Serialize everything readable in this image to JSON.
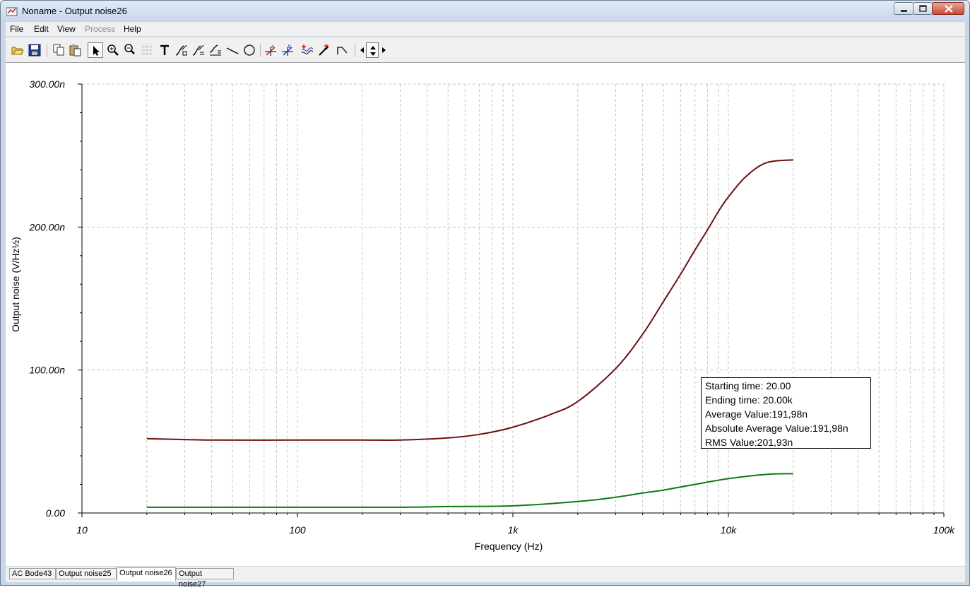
{
  "window": {
    "title": "Noname - Output noise26"
  },
  "menu": [
    {
      "label": "File",
      "enabled": true
    },
    {
      "label": "Edit",
      "enabled": true
    },
    {
      "label": "View",
      "enabled": true
    },
    {
      "label": "Process",
      "enabled": false
    },
    {
      "label": "Help",
      "enabled": true
    }
  ],
  "toolbar": {
    "icons": [
      "open-icon",
      "save-icon",
      "copy-icon",
      "paste-icon",
      "pointer-icon",
      "zoom-in-icon",
      "zoom-out-icon",
      "grid-icon",
      "text-icon",
      "curve-label-icon",
      "curve-label-2-icon",
      "axis-label-icon",
      "line-icon",
      "circle-icon",
      "cursor-a-icon",
      "cursor-b-icon",
      "waveform-icon",
      "probe-icon",
      "step-icon",
      "nav-left-icon",
      "nav-up-down-icon",
      "nav-right-icon"
    ]
  },
  "chart_data": {
    "type": "line",
    "x_scale": "log",
    "xlabel": "Frequency (Hz)",
    "ylabel": "Output noise (V/Hz½)",
    "xlim": [
      10,
      100000
    ],
    "ylim": [
      0,
      300
    ],
    "x_tick_labels": [
      "10",
      "100",
      "1k",
      "10k",
      "100k"
    ],
    "y_tick_labels": [
      "0.00",
      "100.00n",
      "200.00n",
      "300.00n"
    ],
    "y_unit": "n",
    "grid": true,
    "series": [
      {
        "color": "#6b0f0f",
        "points": [
          [
            20,
            52
          ],
          [
            40,
            51
          ],
          [
            100,
            51
          ],
          [
            200,
            51
          ],
          [
            300,
            51
          ],
          [
            500,
            52.5
          ],
          [
            700,
            55
          ],
          [
            1000,
            60
          ],
          [
            1500,
            69
          ],
          [
            2000,
            78
          ],
          [
            3000,
            101
          ],
          [
            4000,
            125
          ],
          [
            5000,
            148
          ],
          [
            6000,
            167
          ],
          [
            7000,
            184
          ],
          [
            8000,
            198
          ],
          [
            9000,
            211
          ],
          [
            10000,
            221
          ],
          [
            12000,
            235
          ],
          [
            15000,
            245
          ],
          [
            20000,
            247
          ]
        ]
      },
      {
        "color": "#0f7a0f",
        "points": [
          [
            20,
            4
          ],
          [
            100,
            4
          ],
          [
            300,
            4
          ],
          [
            500,
            4.5
          ],
          [
            1000,
            5
          ],
          [
            2000,
            8
          ],
          [
            3000,
            11
          ],
          [
            4000,
            14
          ],
          [
            5000,
            16
          ],
          [
            7000,
            20
          ],
          [
            10000,
            24
          ],
          [
            15000,
            27
          ],
          [
            20000,
            27.5
          ]
        ]
      }
    ]
  },
  "stats": {
    "lines": [
      "Starting time: 20.00",
      "Ending time: 20.00k",
      "Average Value:191,98n",
      "Absolute Average Value:191,98n",
      "RMS Value:201,93n"
    ]
  },
  "tabs": [
    {
      "label": "AC Bode43"
    },
    {
      "label": "Output noise25"
    },
    {
      "label": "Output noise26",
      "active": true
    },
    {
      "label": "Output noise27"
    }
  ],
  "colors": {
    "curve1": "#6b0f0f",
    "curve2": "#0f7a0f",
    "grid": "#c8c8c8"
  }
}
